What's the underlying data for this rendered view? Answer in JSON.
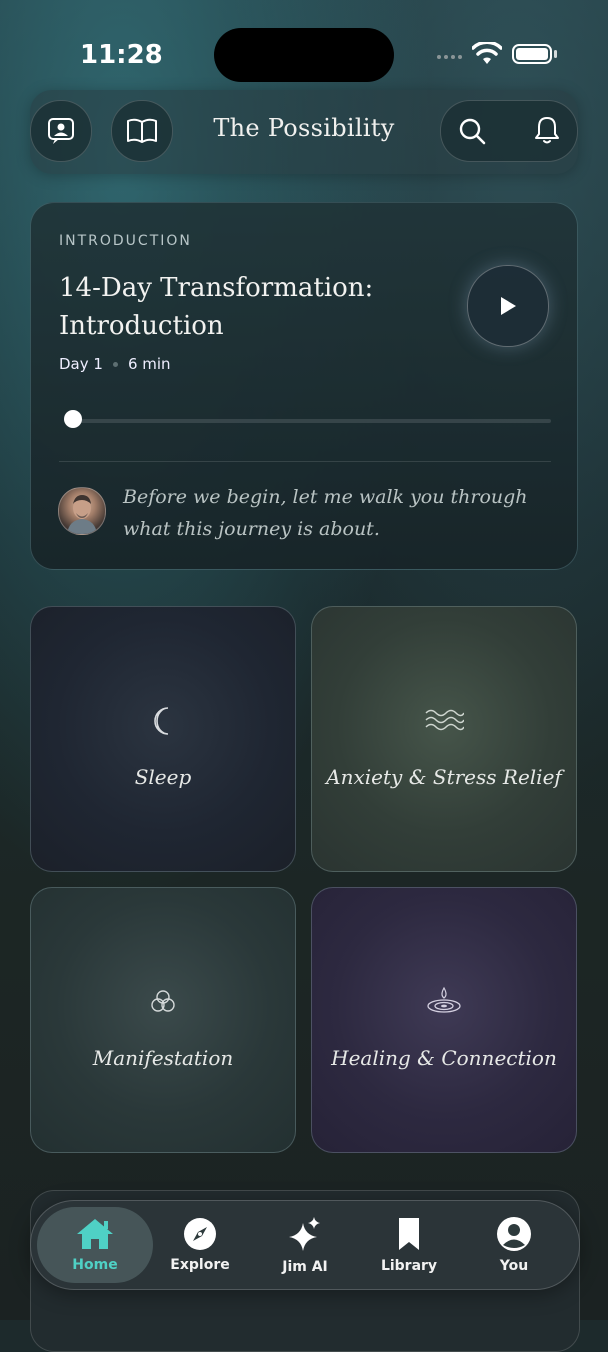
{
  "status_bar": {
    "time": "11:28"
  },
  "header": {
    "brand": "The Possibility",
    "icons": [
      "profile-card-icon",
      "book-icon",
      "search-icon",
      "bell-icon"
    ]
  },
  "intro_card": {
    "label": "INTRODUCTION",
    "title": "14-Day Transformation: Introduction",
    "day": "Day 1",
    "duration": "6 min",
    "progress": 0.0,
    "quote": "Before we begin, let me walk you through what this journey is about."
  },
  "categories": [
    {
      "label": "Sleep",
      "icon": "moon-icon"
    },
    {
      "label": "Anxiety & Stress Relief",
      "icon": "waves-icon"
    },
    {
      "label": "Manifestation",
      "icon": "triquetra-icon"
    },
    {
      "label": "Healing & Connection",
      "icon": "ripple-drop-icon"
    }
  ],
  "tabbar": {
    "tabs": [
      {
        "label": "Home",
        "icon": "home-icon",
        "active": true
      },
      {
        "label": "Explore",
        "icon": "compass-icon",
        "active": false
      },
      {
        "label": "Jim AI",
        "icon": "sparkles-icon",
        "active": false
      },
      {
        "label": "Library",
        "icon": "bookmark-icon",
        "active": false
      },
      {
        "label": "You",
        "icon": "user-circle-icon",
        "active": false
      }
    ],
    "active_color": "#4fd1c5"
  }
}
